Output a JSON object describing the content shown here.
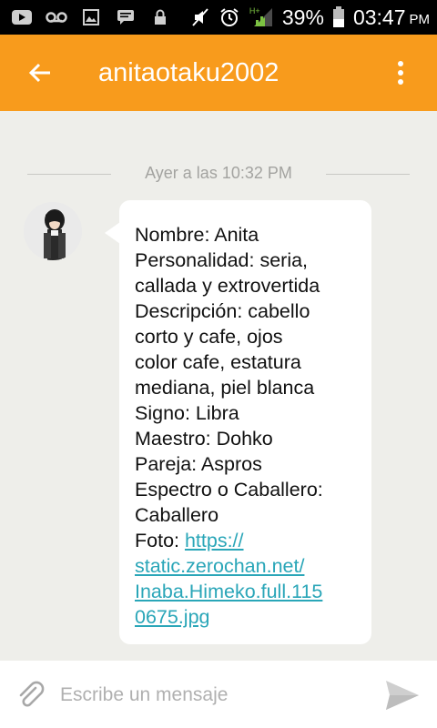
{
  "status_bar": {
    "battery_percent": "39%",
    "time": "03:47",
    "ampm": "PM",
    "network": "H+",
    "icons": [
      "youtube-icon",
      "voicemail-icon",
      "gallery-icon",
      "chat-icon",
      "lock-icon",
      "mute-icon",
      "alarm-icon",
      "signal-icon",
      "battery-icon"
    ]
  },
  "header": {
    "title": "anitaotaku2002",
    "back_icon": "back-arrow-icon",
    "menu_icon": "more-vert-icon",
    "color": "#f89b1c"
  },
  "chat": {
    "date_label": "Ayer a las 10:32 PM",
    "message": {
      "lines": [
        "Nombre: Anita",
        "Personalidad: seria,",
        "callada y extrovertida",
        "Descripción: cabello",
        "corto y cafe, ojos",
        "color cafe, estatura",
        "mediana, piel blanca",
        "Signo: Libra",
        "Maestro: Dohko",
        "Pareja: Aspros",
        "Espectro o Caballero:",
        "Caballero"
      ],
      "photo_label": "Foto: ",
      "link_lines": [
        "https://",
        "static.zerochan.net/",
        "Inaba.Himeko.full.115",
        "0675.jpg"
      ]
    }
  },
  "composer": {
    "placeholder": "Escribe un mensaje",
    "attach_icon": "paperclip-icon",
    "send_icon": "send-icon"
  }
}
